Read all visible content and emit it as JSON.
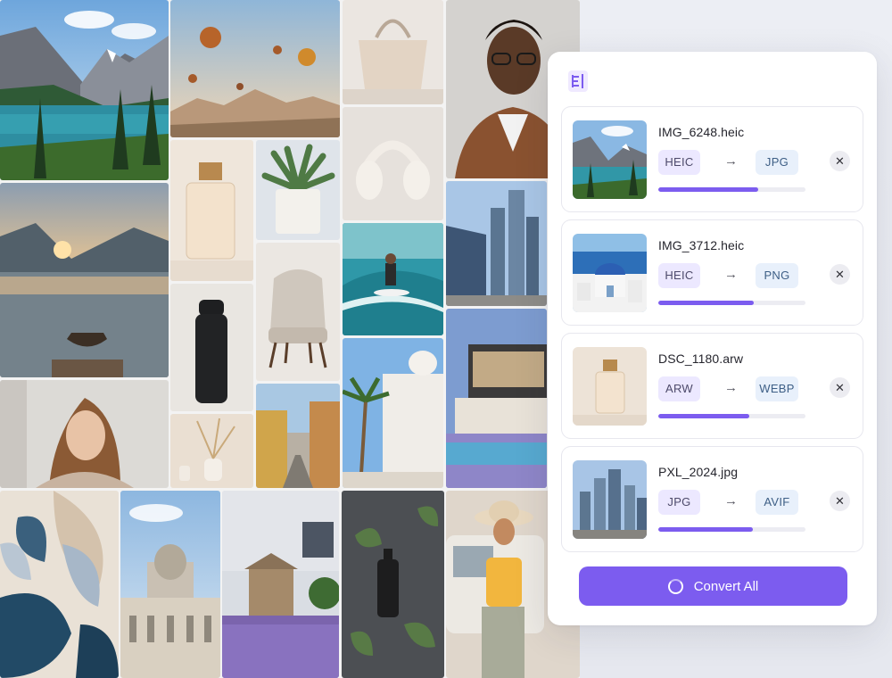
{
  "app": {
    "logo_icon": "document-lines-icon",
    "accent_color": "#7c5cef"
  },
  "gallery": {
    "tiles": [
      "mountain-lake-photo",
      "hot-air-balloons-photo",
      "handbag-photo",
      "portrait-man-glasses-photo",
      "sunset-lake-rowboat-photo",
      "perfume-bottle-photo",
      "succulent-pot-photo",
      "headphones-photo",
      "skyscrapers-photo",
      "water-bottle-photo",
      "armchair-photo",
      "surfer-photo",
      "modern-villa-pool-photo",
      "portrait-woman-photo",
      "dried-flowers-vase-photo",
      "old-town-street-photo",
      "palm-white-building-photo",
      "abstract-leaves-art-photo",
      "domed-palace-photo",
      "lavender-stone-house-photo",
      "serum-bottle-leaves-photo",
      "woman-hat-van-photo"
    ]
  },
  "files": [
    {
      "name": "IMG_6248.heic",
      "from": "HEIC",
      "to": "JPG",
      "progress": 0.68,
      "thumb": "mountain-lake-thumb"
    },
    {
      "name": "IMG_3712.heic",
      "from": "HEIC",
      "to": "PNG",
      "progress": 0.65,
      "thumb": "santorini-dome-thumb"
    },
    {
      "name": "DSC_1180.arw",
      "from": "ARW",
      "to": "WEBP",
      "progress": 0.62,
      "thumb": "perfume-bottle-thumb"
    },
    {
      "name": "PXL_2024.jpg",
      "from": "JPG",
      "to": "AVIF",
      "progress": 0.64,
      "thumb": "skyscrapers-thumb"
    }
  ],
  "actions": {
    "convert_label": "Convert All",
    "convert_icon": "loading-ring-icon",
    "remove_icon": "close-icon",
    "arrow_icon": "right-arrow-icon",
    "arrow_glyph": "→",
    "remove_glyph": "✕"
  }
}
